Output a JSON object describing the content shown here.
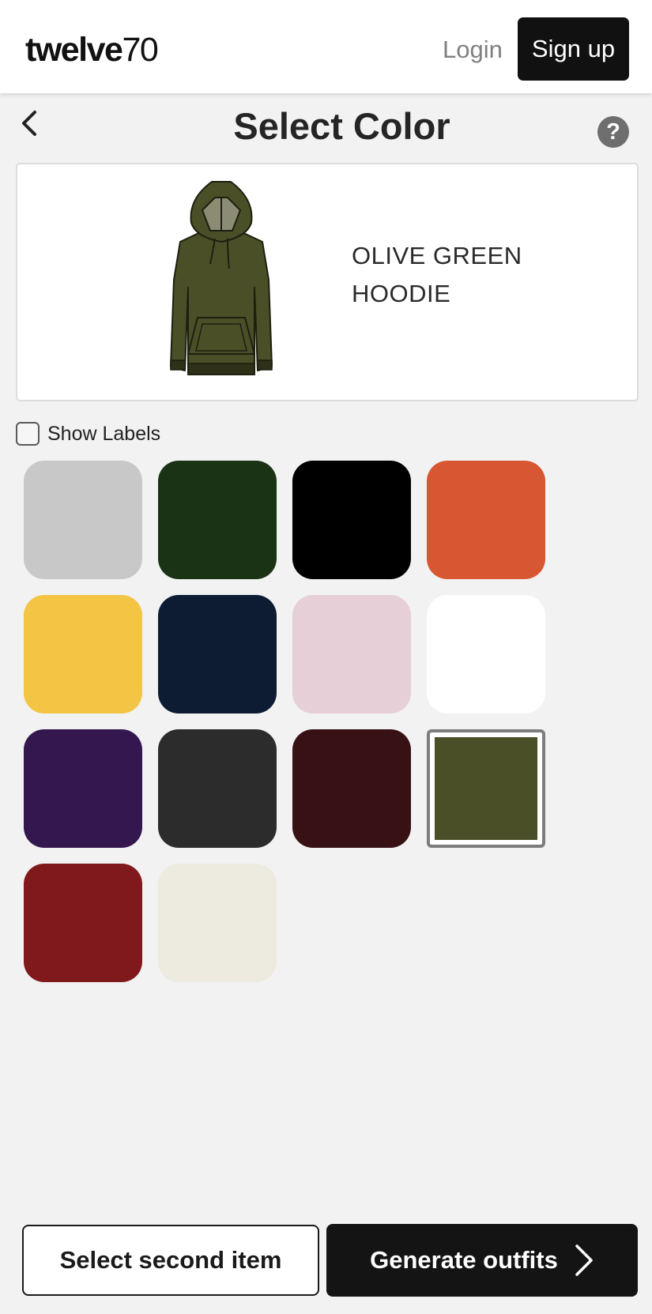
{
  "header": {
    "logo_bold": "twelve",
    "logo_light": "70",
    "login_label": "Login",
    "signup_label": "Sign up"
  },
  "page": {
    "title": "Select Color",
    "help_label": "?"
  },
  "product": {
    "name_line1": "OLIVE GREEN",
    "name_line2": "HOODIE",
    "color": "#4a4f27"
  },
  "options": {
    "show_labels_label": "Show Labels",
    "show_labels_checked": false
  },
  "swatches": [
    {
      "color": "#c8c8c8"
    },
    {
      "color": "#1a3315"
    },
    {
      "color": "#000000"
    },
    {
      "color": "#d85733"
    },
    {
      "color": "#f4c445"
    },
    {
      "color": "#0d1c33"
    },
    {
      "color": "#e6cfd7"
    },
    {
      "color": "#ffffff"
    },
    {
      "color": "#351750"
    },
    {
      "color": "#2c2c2c"
    },
    {
      "color": "#381115"
    },
    {
      "color": "#4a4f27",
      "selected": true
    },
    {
      "color": "#80191b"
    },
    {
      "color": "#edebe0"
    }
  ],
  "footer": {
    "second_item_label": "Select second item",
    "generate_label": "Generate outfits"
  }
}
